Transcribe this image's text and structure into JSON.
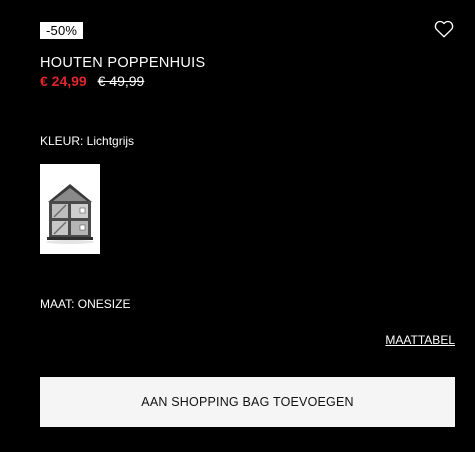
{
  "product": {
    "discount_badge": "-50%",
    "title": "HOUTEN POPPENHUIS",
    "price_sale": "€ 24,99",
    "price_original": "€ 49,99",
    "wishlist_icon": "heart-outline-icon"
  },
  "color": {
    "label": "KLEUR: Lichtgrijs",
    "swatch_alt": "Houten poppenhuis lichtgrijs"
  },
  "size": {
    "label": "MAAT: ONESIZE",
    "guide_link": "MAATTABEL"
  },
  "actions": {
    "add_to_bag": "AAN SHOPPING BAG TOEVOEGEN"
  },
  "colors": {
    "background": "#000000",
    "sale_price": "#e0252b",
    "button_bg": "#f5f5f5",
    "text": "#ffffff"
  }
}
